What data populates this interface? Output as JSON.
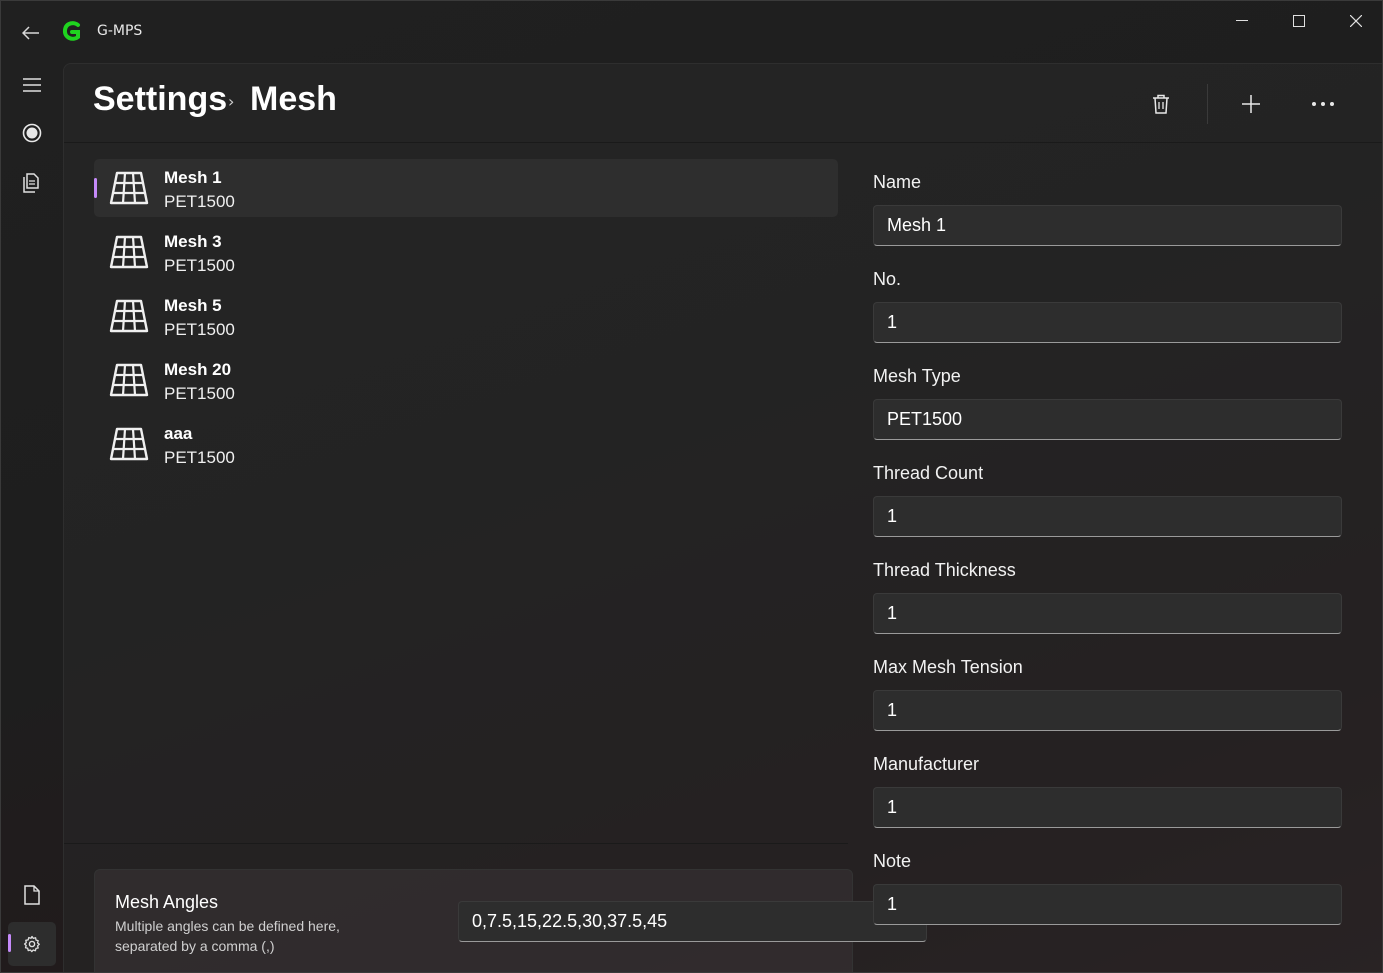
{
  "app": {
    "title": "G-MPS",
    "accent": "#c58af9",
    "logo_color": "#1fd31f"
  },
  "titlebar": {
    "back_icon": "back-arrow-icon",
    "minimize_icon": "minimize-icon",
    "maximize_icon": "maximize-icon",
    "close_icon": "close-icon"
  },
  "rail": {
    "items": [
      {
        "icon": "hamburger-menu-icon"
      },
      {
        "icon": "record-icon"
      },
      {
        "icon": "documents-icon"
      },
      {
        "icon": "document-icon"
      },
      {
        "icon": "settings-gear-icon",
        "active": true
      }
    ]
  },
  "header": {
    "breadcrumb_root": "Settings",
    "breadcrumb_separator": "›",
    "breadcrumb_current": "Mesh",
    "delete_icon": "trash-icon",
    "add_icon": "plus-icon",
    "more_icon": "more-dots-icon"
  },
  "mesh_list": [
    {
      "name": "Mesh 1",
      "type": "PET1500",
      "selected": true
    },
    {
      "name": "Mesh 3",
      "type": "PET1500"
    },
    {
      "name": "Mesh 5",
      "type": "PET1500"
    },
    {
      "name": "Mesh 20",
      "type": "PET1500"
    },
    {
      "name": "aaa",
      "type": "PET1500"
    }
  ],
  "angles": {
    "title": "Mesh Angles",
    "description": "Multiple angles can be defined here, separated by a comma (,)",
    "value": "0,7.5,15,22.5,30,37.5,45"
  },
  "form": {
    "name": {
      "label": "Name",
      "value": "Mesh 1"
    },
    "no": {
      "label": "No.",
      "value": "1"
    },
    "mesh_type": {
      "label": "Mesh Type",
      "value": "PET1500"
    },
    "thread_count": {
      "label": "Thread Count",
      "value": "1"
    },
    "thread_thickness": {
      "label": "Thread Thickness",
      "value": "1"
    },
    "max_mesh_tension": {
      "label": "Max Mesh Tension",
      "value": "1"
    },
    "manufacturer": {
      "label": "Manufacturer",
      "value": "1"
    },
    "note": {
      "label": "Note",
      "value": "1"
    }
  }
}
